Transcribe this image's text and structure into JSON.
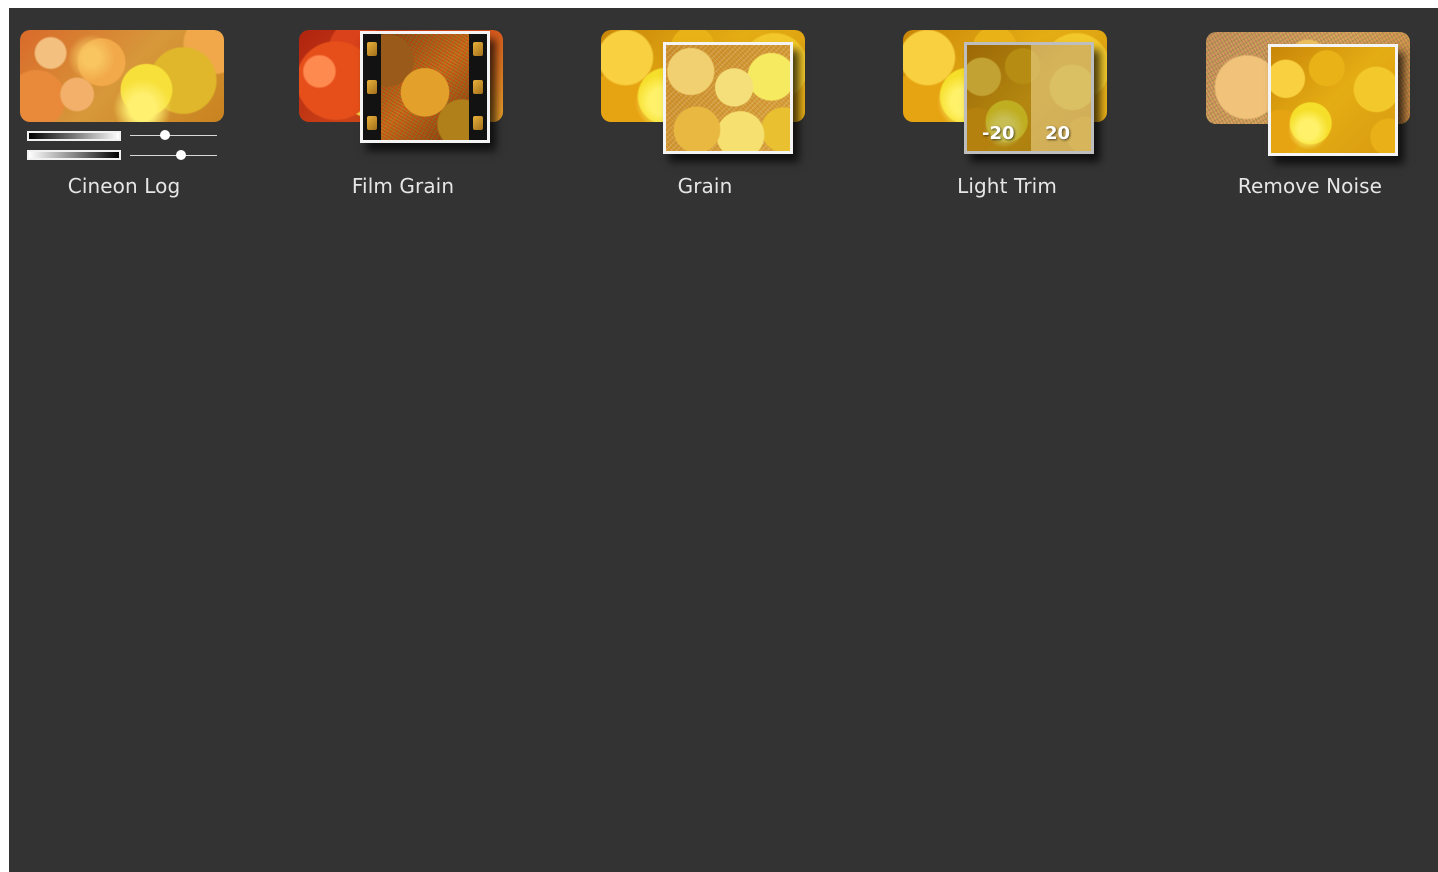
{
  "effects": [
    {
      "label": "Cineon Log",
      "icon": "cineon-log-icon"
    },
    {
      "label": "Film Grain",
      "icon": "film-grain-icon"
    },
    {
      "label": "Grain",
      "icon": "grain-icon"
    },
    {
      "label": "Light Trim",
      "icon": "light-trim-icon",
      "trim_low": "-20",
      "trim_high": "20"
    },
    {
      "label": "Remove Noise",
      "icon": "remove-noise-icon"
    }
  ],
  "cineon_sliders": {
    "top_level": 0.4,
    "bottom_level": 0.59
  },
  "colors": {
    "panel_background": "#333333",
    "label_text": "#e6e6e6"
  }
}
